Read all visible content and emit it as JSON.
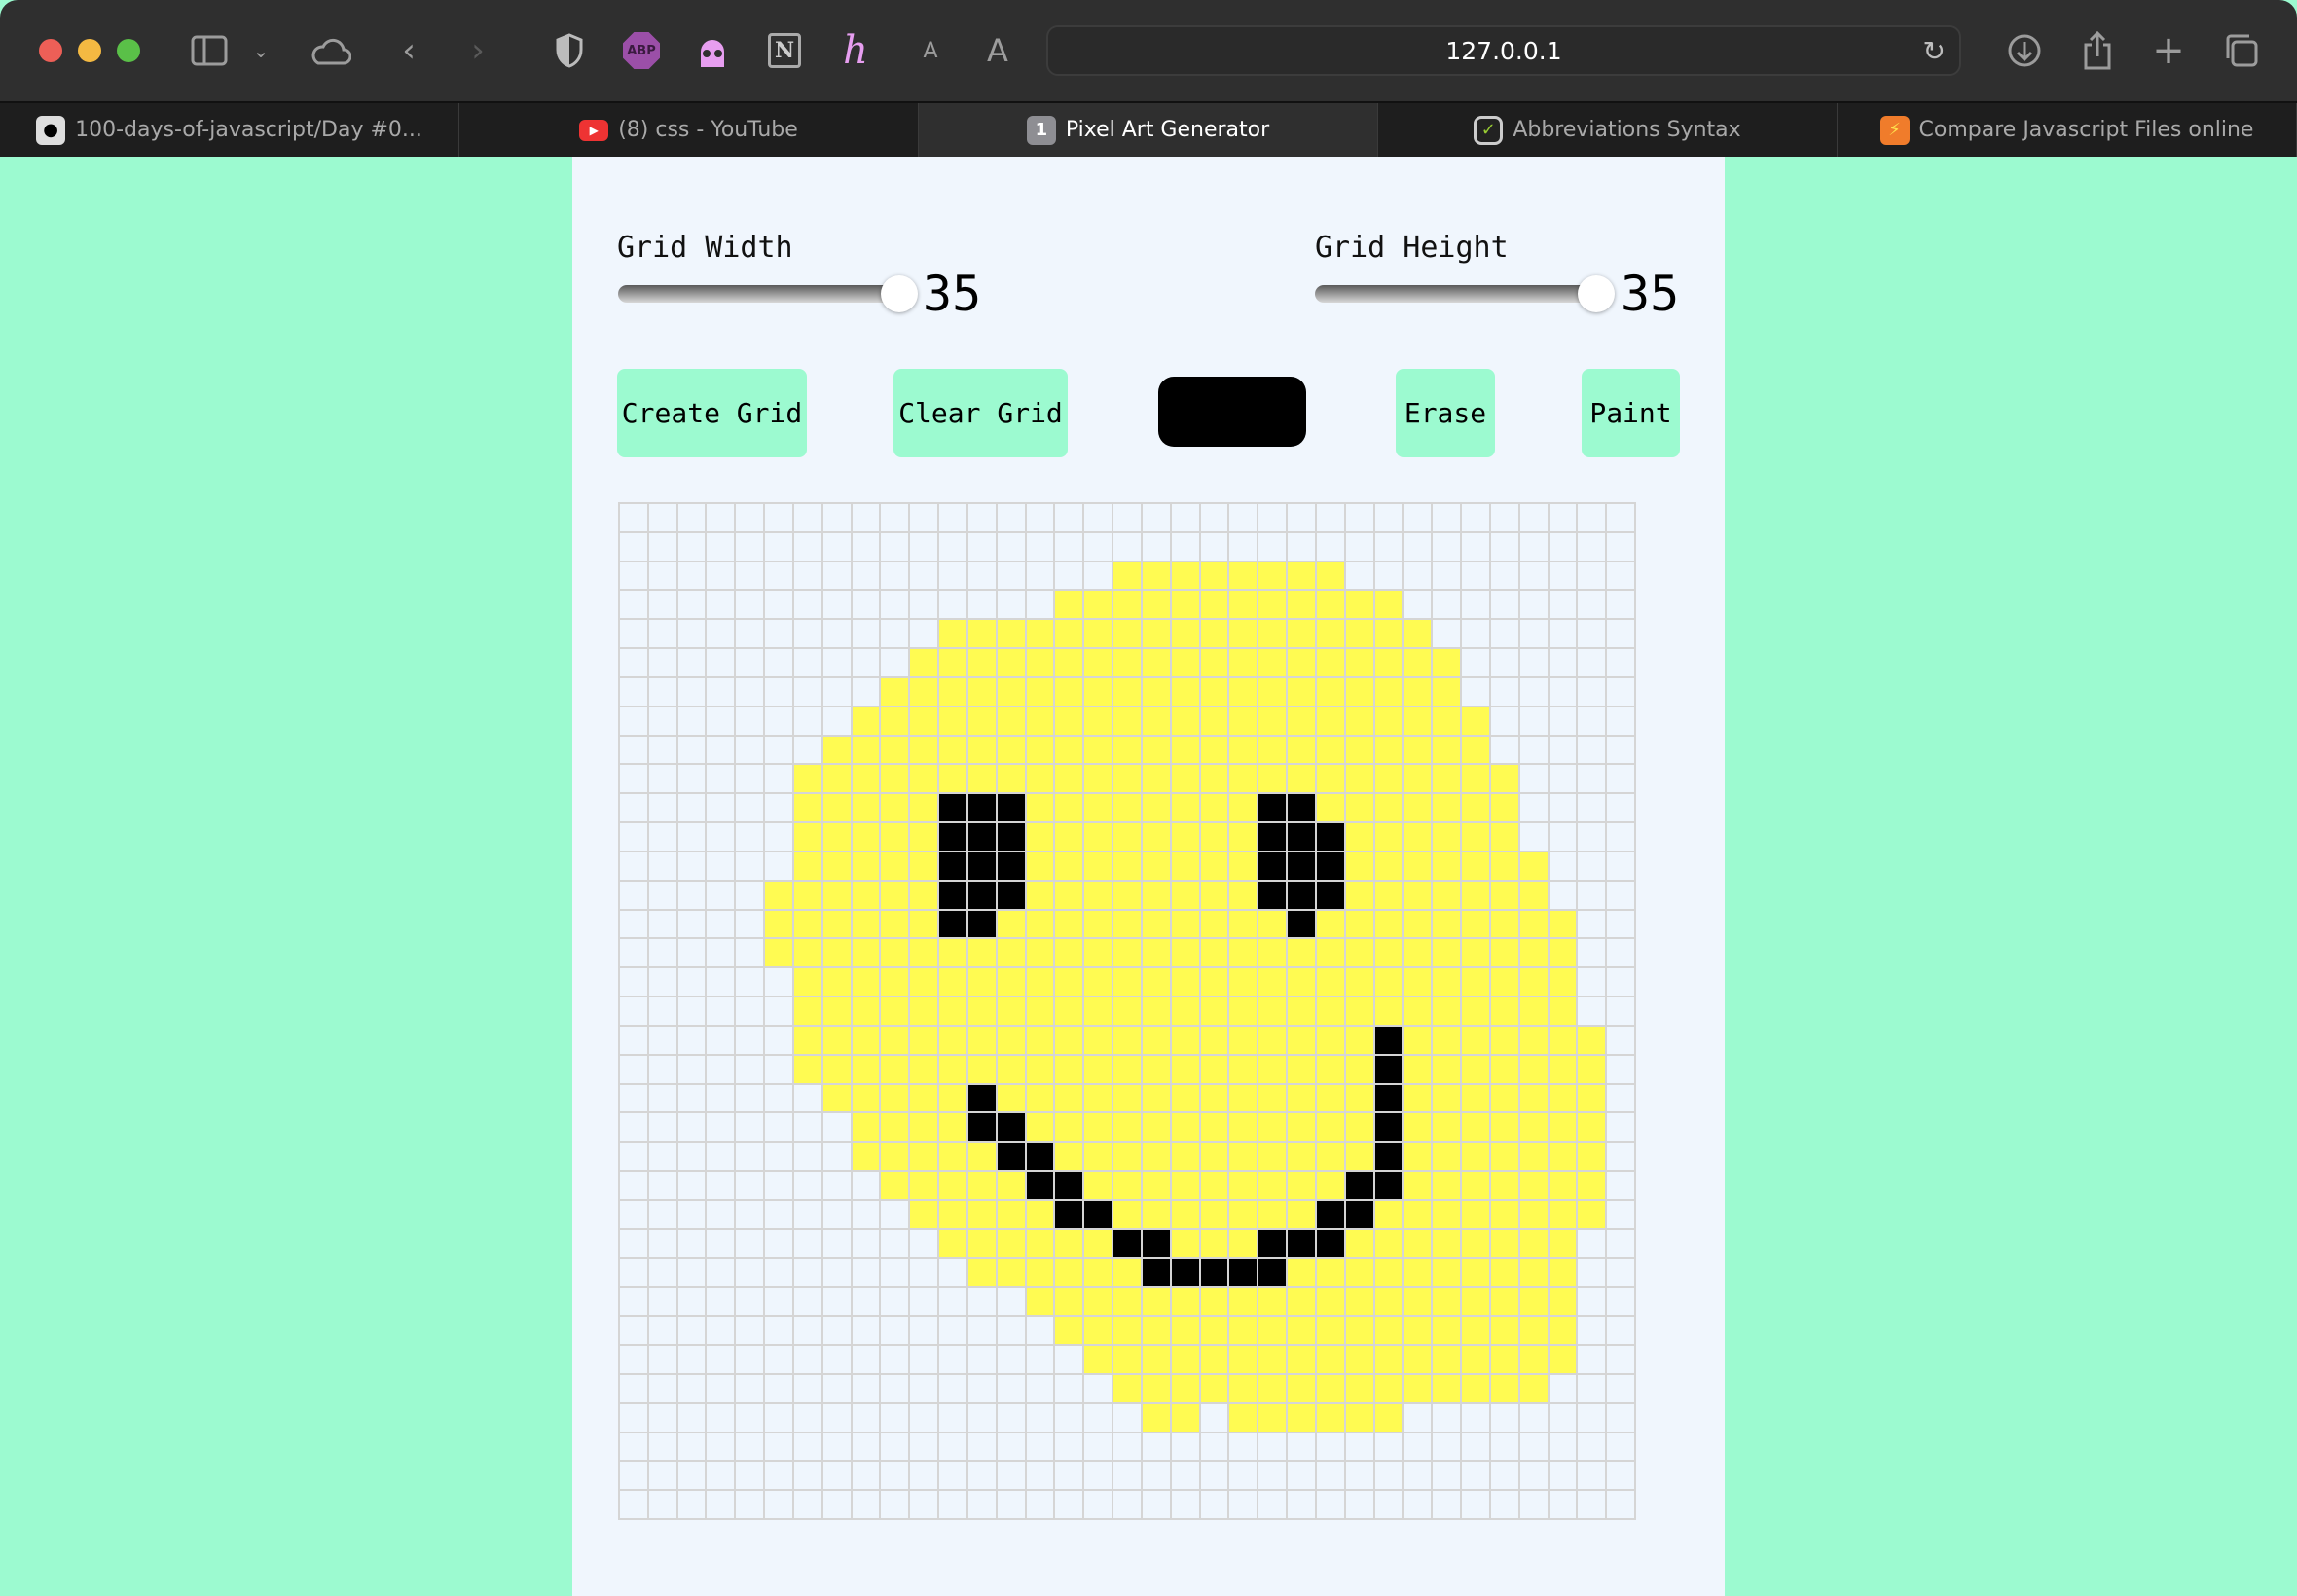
{
  "browser": {
    "url": "127.0.0.1",
    "tabs": [
      {
        "title": "100-days-of-javascript/Day #0...",
        "icon": "github-icon",
        "active": false
      },
      {
        "title": "(8) css - YouTube",
        "icon": "youtube-icon",
        "active": false
      },
      {
        "title": "Pixel Art Generator",
        "icon": "1",
        "active": true
      },
      {
        "title": "Abbreviations Syntax",
        "icon": "emmet-icon",
        "active": false
      },
      {
        "title": "Compare Javascript Files online",
        "icon": "lightning-icon",
        "active": false
      }
    ],
    "extensions": {
      "abp": "ABP",
      "notion": "N",
      "font_small": "A",
      "font_large": "A"
    }
  },
  "controls": {
    "width_label": "Grid Width",
    "width_value": "35",
    "height_label": "Grid Height",
    "height_value": "35",
    "create_label": "Create Grid",
    "clear_label": "Clear Grid",
    "erase_label": "Erase",
    "paint_label": "Paint",
    "selected_color": "#000000"
  },
  "colors": {
    "page_bg": "#9cfad0",
    "panel_bg": "#f0f6fd",
    "empty": "#eff6fd",
    "yellow": "#fffb52",
    "black": "#000000",
    "gridline": "#d5d5d5"
  },
  "pixel_grid": {
    "columns": 35,
    "rows_count": 35,
    "legend": {
      ".": "empty",
      "y": "yellow",
      "b": "black"
    },
    "rows_rle": [
      [
        [
          35,
          "."
        ]
      ],
      [
        [
          35,
          "."
        ]
      ],
      [
        [
          17,
          "."
        ],
        [
          8,
          "y"
        ],
        [
          10,
          "."
        ]
      ],
      [
        [
          15,
          "."
        ],
        [
          12,
          "y"
        ],
        [
          8,
          "."
        ]
      ],
      [
        [
          11,
          "."
        ],
        [
          17,
          "y"
        ],
        [
          7,
          "."
        ]
      ],
      [
        [
          10,
          "."
        ],
        [
          19,
          "y"
        ],
        [
          6,
          "."
        ]
      ],
      [
        [
          9,
          "."
        ],
        [
          20,
          "y"
        ],
        [
          6,
          "."
        ]
      ],
      [
        [
          8,
          "."
        ],
        [
          22,
          "y"
        ],
        [
          5,
          "."
        ]
      ],
      [
        [
          7,
          "."
        ],
        [
          23,
          "y"
        ],
        [
          5,
          "."
        ]
      ],
      [
        [
          6,
          "."
        ],
        [
          25,
          "y"
        ],
        [
          4,
          "."
        ]
      ],
      [
        [
          6,
          "."
        ],
        [
          5,
          "y"
        ],
        [
          3,
          "b"
        ],
        [
          8,
          "y"
        ],
        [
          2,
          "b"
        ],
        [
          7,
          "y"
        ],
        [
          4,
          "."
        ]
      ],
      [
        [
          6,
          "."
        ],
        [
          5,
          "y"
        ],
        [
          3,
          "b"
        ],
        [
          8,
          "y"
        ],
        [
          3,
          "b"
        ],
        [
          6,
          "y"
        ],
        [
          4,
          "."
        ]
      ],
      [
        [
          6,
          "."
        ],
        [
          5,
          "y"
        ],
        [
          3,
          "b"
        ],
        [
          8,
          "y"
        ],
        [
          3,
          "b"
        ],
        [
          7,
          "y"
        ],
        [
          3,
          "."
        ]
      ],
      [
        [
          5,
          "."
        ],
        [
          6,
          "y"
        ],
        [
          3,
          "b"
        ],
        [
          8,
          "y"
        ],
        [
          3,
          "b"
        ],
        [
          7,
          "y"
        ],
        [
          3,
          "."
        ]
      ],
      [
        [
          5,
          "."
        ],
        [
          6,
          "y"
        ],
        [
          2,
          "b"
        ],
        [
          10,
          "y"
        ],
        [
          1,
          "b"
        ],
        [
          9,
          "y"
        ],
        [
          2,
          "."
        ]
      ],
      [
        [
          5,
          "."
        ],
        [
          28,
          "y"
        ],
        [
          2,
          "."
        ]
      ],
      [
        [
          6,
          "."
        ],
        [
          27,
          "y"
        ],
        [
          2,
          "."
        ]
      ],
      [
        [
          6,
          "."
        ],
        [
          27,
          "y"
        ],
        [
          2,
          "."
        ]
      ],
      [
        [
          6,
          "."
        ],
        [
          20,
          "y"
        ],
        [
          1,
          "b"
        ],
        [
          7,
          "y"
        ],
        [
          1,
          "."
        ]
      ],
      [
        [
          6,
          "."
        ],
        [
          20,
          "y"
        ],
        [
          1,
          "b"
        ],
        [
          7,
          "y"
        ],
        [
          1,
          "."
        ]
      ],
      [
        [
          7,
          "."
        ],
        [
          5,
          "y"
        ],
        [
          1,
          "b"
        ],
        [
          13,
          "y"
        ],
        [
          1,
          "b"
        ],
        [
          7,
          "y"
        ],
        [
          1,
          "."
        ]
      ],
      [
        [
          8,
          "."
        ],
        [
          4,
          "y"
        ],
        [
          2,
          "b"
        ],
        [
          12,
          "y"
        ],
        [
          1,
          "b"
        ],
        [
          7,
          "y"
        ],
        [
          1,
          "."
        ]
      ],
      [
        [
          8,
          "."
        ],
        [
          5,
          "y"
        ],
        [
          2,
          "b"
        ],
        [
          11,
          "y"
        ],
        [
          1,
          "b"
        ],
        [
          7,
          "y"
        ],
        [
          1,
          "."
        ]
      ],
      [
        [
          9,
          "."
        ],
        [
          5,
          "y"
        ],
        [
          2,
          "b"
        ],
        [
          9,
          "y"
        ],
        [
          2,
          "b"
        ],
        [
          7,
          "y"
        ],
        [
          1,
          "."
        ]
      ],
      [
        [
          10,
          "."
        ],
        [
          5,
          "y"
        ],
        [
          2,
          "b"
        ],
        [
          7,
          "y"
        ],
        [
          2,
          "b"
        ],
        [
          8,
          "y"
        ],
        [
          1,
          "."
        ]
      ],
      [
        [
          11,
          "."
        ],
        [
          6,
          "y"
        ],
        [
          2,
          "b"
        ],
        [
          3,
          "y"
        ],
        [
          3,
          "b"
        ],
        [
          8,
          "y"
        ],
        [
          2,
          "."
        ]
      ],
      [
        [
          12,
          "."
        ],
        [
          6,
          "y"
        ],
        [
          5,
          "b"
        ],
        [
          10,
          "y"
        ],
        [
          2,
          "."
        ]
      ],
      [
        [
          14,
          "."
        ],
        [
          19,
          "y"
        ],
        [
          2,
          "."
        ]
      ],
      [
        [
          15,
          "."
        ],
        [
          18,
          "y"
        ],
        [
          2,
          "."
        ]
      ],
      [
        [
          16,
          "."
        ],
        [
          17,
          "y"
        ],
        [
          2,
          "."
        ]
      ],
      [
        [
          17,
          "."
        ],
        [
          15,
          "y"
        ],
        [
          3,
          "."
        ]
      ],
      [
        [
          18,
          "."
        ],
        [
          2,
          "y"
        ],
        [
          1,
          "."
        ],
        [
          6,
          "y"
        ],
        [
          8,
          "."
        ]
      ],
      [
        [
          35,
          "."
        ]
      ],
      [
        [
          35,
          "."
        ]
      ],
      [
        [
          35,
          "."
        ]
      ]
    ]
  }
}
